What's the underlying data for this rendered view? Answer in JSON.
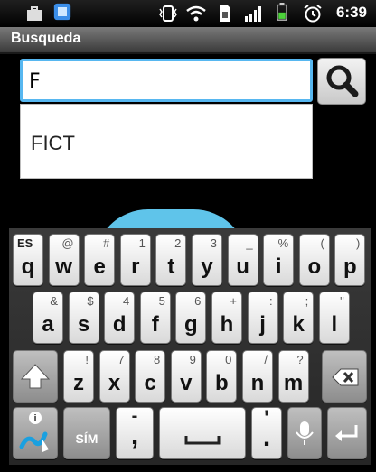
{
  "status_bar": {
    "time": "6:39",
    "icons": [
      "briefcase-icon",
      "app-notification-icon",
      "vibrate-icon",
      "wifi-icon",
      "sim-icon",
      "signal-icon",
      "battery-icon",
      "alarm-icon"
    ]
  },
  "title_bar": {
    "title": "Busqueda"
  },
  "search": {
    "value": "F",
    "button_icon": "magnifier-icon"
  },
  "suggestions": [
    "FICT"
  ],
  "keyboard": {
    "row1": [
      {
        "main": "q",
        "alt": "ES"
      },
      {
        "main": "w",
        "alt": "@"
      },
      {
        "main": "e",
        "alt": "#"
      },
      {
        "main": "r",
        "alt": "1"
      },
      {
        "main": "t",
        "alt": "2"
      },
      {
        "main": "y",
        "alt": "3"
      },
      {
        "main": "u",
        "alt": "_"
      },
      {
        "main": "i",
        "alt": "%"
      },
      {
        "main": "o",
        "alt": "("
      },
      {
        "main": "p",
        "alt": ")"
      }
    ],
    "row2": [
      {
        "main": "a",
        "alt": "&"
      },
      {
        "main": "s",
        "alt": "$"
      },
      {
        "main": "d",
        "alt": "4"
      },
      {
        "main": "f",
        "alt": "5"
      },
      {
        "main": "g",
        "alt": "6"
      },
      {
        "main": "h",
        "alt": "+"
      },
      {
        "main": "j",
        "alt": ":"
      },
      {
        "main": "k",
        "alt": ";"
      },
      {
        "main": "l",
        "alt": "\""
      }
    ],
    "row3": [
      {
        "main": "z",
        "alt": "!"
      },
      {
        "main": "x",
        "alt": "7"
      },
      {
        "main": "c",
        "alt": "8"
      },
      {
        "main": "v",
        "alt": "9"
      },
      {
        "main": "b",
        "alt": "0"
      },
      {
        "main": "n",
        "alt": "/"
      },
      {
        "main": "m",
        "alt": "?"
      }
    ],
    "sym_label": "SÍM",
    "comma_label": ",",
    "comma_alt": "-",
    "period_label": ".",
    "period_alt": "'",
    "colors": {
      "accent": "#57b7f0",
      "bubble": "#5fc4ea"
    }
  }
}
